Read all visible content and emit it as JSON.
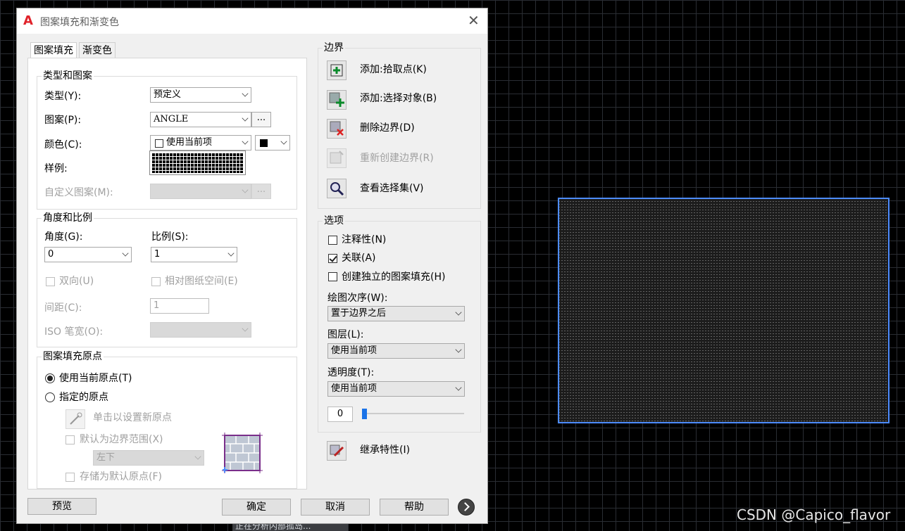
{
  "dialog": {
    "title": "图案填充和渐变色"
  },
  "tabs": [
    {
      "label": "图案填充"
    },
    {
      "label": "渐变色"
    }
  ],
  "type_pattern": {
    "legend": "类型和图案",
    "type_label": "类型(Y):",
    "type_value": "预定义",
    "pattern_label": "图案(P):",
    "pattern_value": "ANGLE",
    "color_label": "颜色(C):",
    "color_value": "使用当前项",
    "sample_label": "样例:",
    "custom_label": "自定义图案(M):",
    "more": "..."
  },
  "angle_scale": {
    "legend": "角度和比例",
    "angle_label": "角度(G):",
    "angle_value": "0",
    "scale_label": "比例(S):",
    "scale_value": "1",
    "double_label": "双向(U)",
    "relative_label": "相对图纸空间(E)",
    "spacing_label": "间距(C):",
    "spacing_value": "1",
    "iso_label": "ISO 笔宽(O):"
  },
  "origin": {
    "legend": "图案填充原点",
    "use_current": "使用当前原点(T)",
    "specified": "指定的原点",
    "click_set": "单击以设置新原点",
    "default_extents": "默认为边界范围(X)",
    "position_value": "左下",
    "store_default": "存储为默认原点(F)"
  },
  "boundaries": {
    "legend": "边界",
    "add_pick": "添加:拾取点(K)",
    "add_select": "添加:选择对象(B)",
    "remove": "删除边界(D)",
    "recreate": "重新创建边界(R)",
    "view": "查看选择集(V)"
  },
  "options": {
    "legend": "选项",
    "annotative": "注释性(N)",
    "associative": "关联(A)",
    "separate": "创建独立的图案填充(H)",
    "draw_order_label": "绘图次序(W):",
    "draw_order_value": "置于边界之后",
    "layer_label": "图层(L):",
    "layer_value": "使用当前项",
    "transparency_label": "透明度(T):",
    "transparency_value": "使用当前项",
    "transparency_amount": "0"
  },
  "inherit": "继承特性(I)",
  "buttons": {
    "preview": "预览",
    "ok": "确定",
    "cancel": "取消",
    "help": "帮助"
  },
  "status_text": "正在分析内部孤岛...",
  "watermark": "CSDN @Capico_flavor",
  "colors": {
    "accent": "#1a73e8",
    "selection": "#4d8cff",
    "title_icon": "#e0222a"
  }
}
